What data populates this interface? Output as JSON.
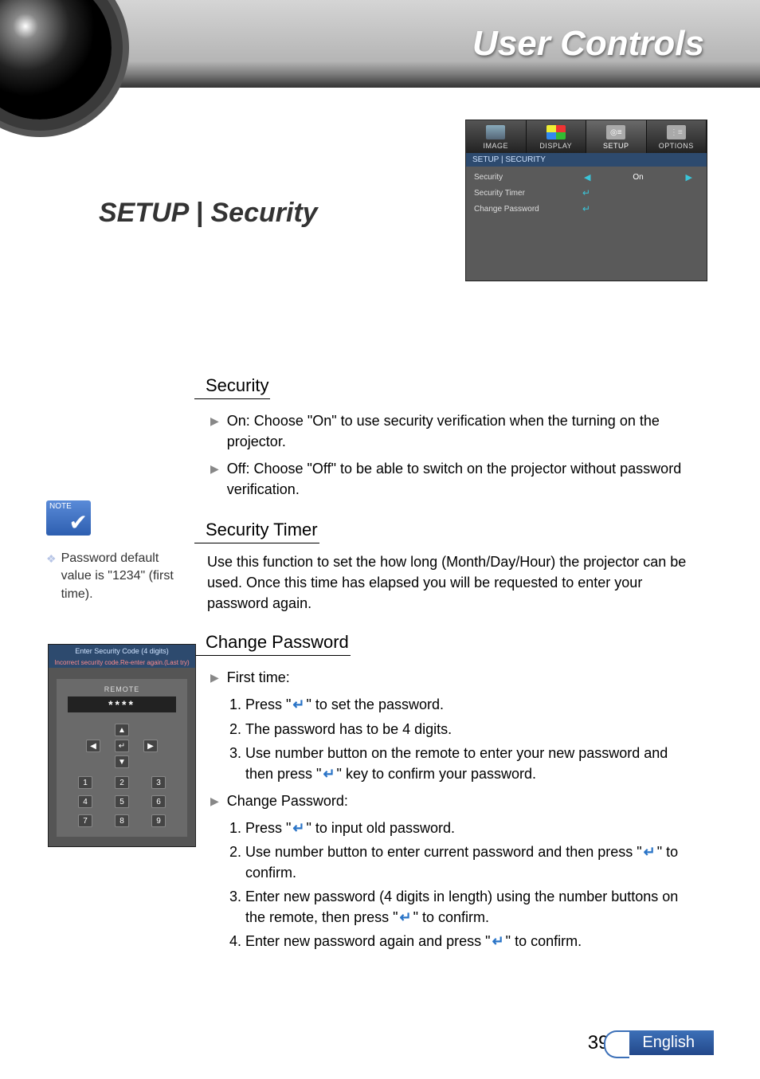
{
  "header": {
    "title": "User Controls"
  },
  "page_title": "SETUP | Security",
  "osd": {
    "tabs": [
      {
        "label": "IMAGE"
      },
      {
        "label": "DISPLAY"
      },
      {
        "label": "SETUP"
      },
      {
        "label": "OPTIONS"
      }
    ],
    "breadcrumb": "SETUP | SECURITY",
    "rows": {
      "security": {
        "label": "Security",
        "value": "On"
      },
      "timer": {
        "label": "Security Timer"
      },
      "change": {
        "label": "Change Password"
      }
    }
  },
  "sections": {
    "security": {
      "heading": "Security",
      "on": "On: Choose \"On\" to use security verification when the turning on the projector.",
      "off": "Off: Choose \"Off\" to be able to switch on the projector without password verification."
    },
    "timer": {
      "heading": "Security Timer",
      "body": "Use this function to set the how long (Month/Day/Hour) the projector can be used. Once this time has elapsed you will be requested to enter your password again."
    },
    "change": {
      "heading": "Change Password",
      "first_time_label": "First time:",
      "ft1_a": "Press \"",
      "ft1_b": "\" to set the password.",
      "ft2": "The password has to be 4 digits.",
      "ft3_a": "Use number button on the remote to enter your new password and then press \"",
      "ft3_b": "\" key to confirm your password.",
      "cp_label": "Change Password:",
      "cp1_a": "Press \"",
      "cp1_b": "\" to input old password.",
      "cp2_a": "Use number button to enter current password and then press \"",
      "cp2_b": "\" to confirm.",
      "cp3_a": "Enter new password (4 digits in length) using the number buttons on the remote, then press \"",
      "cp3_b": "\" to confirm.",
      "cp4_a": "Enter new password again and press \"",
      "cp4_b": "\" to confirm."
    }
  },
  "note": {
    "badge": "NOTE",
    "text": "Password default value is \"1234\" (first time)."
  },
  "pw_pad": {
    "title": "Enter Security Code (4 digits)",
    "error": "Incorrect security code.Re-enter again.(Last try)",
    "remote_label": "REMOTE",
    "mask": "****",
    "keys": [
      "1",
      "2",
      "3",
      "4",
      "5",
      "6",
      "7",
      "8",
      "9"
    ]
  },
  "footer": {
    "page": "39",
    "lang": "English"
  }
}
